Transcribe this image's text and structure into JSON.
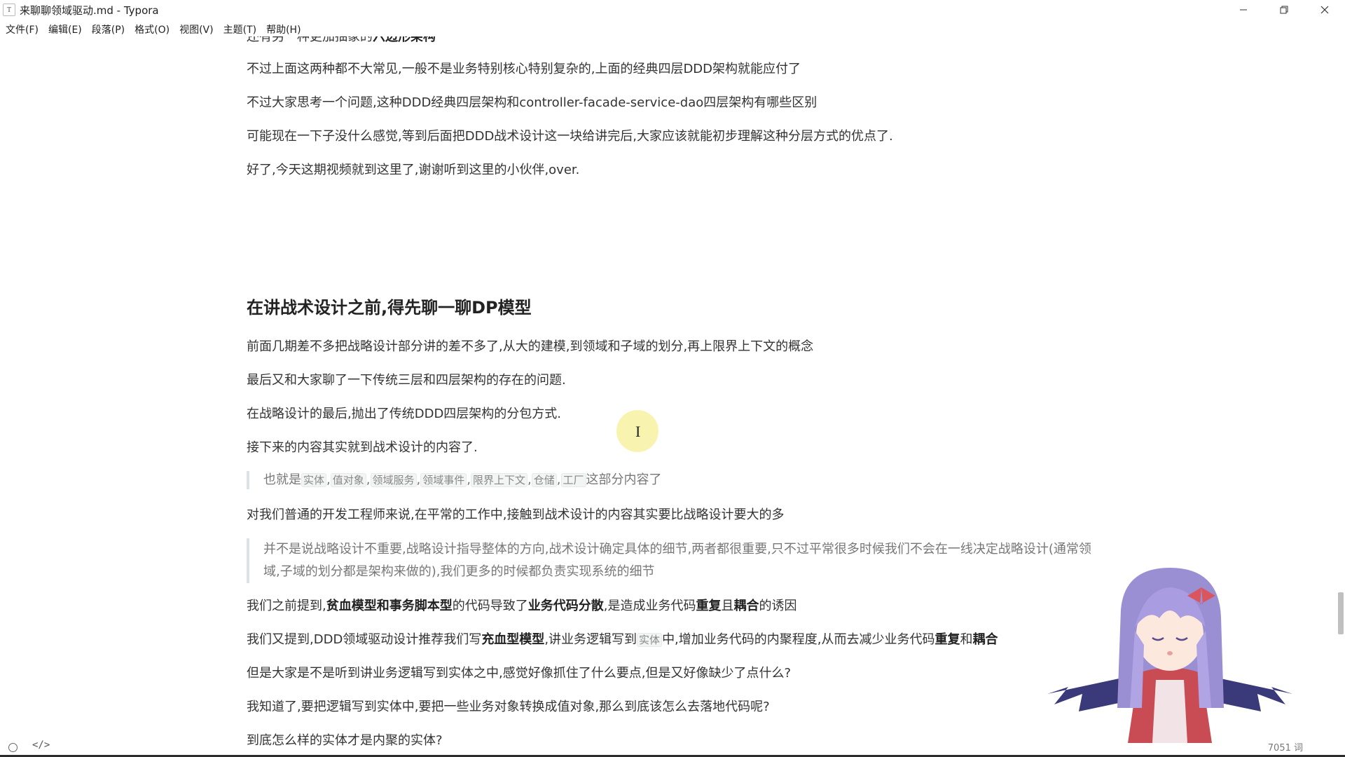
{
  "window": {
    "title": "来聊聊领域驱动.md - Typora",
    "icon_glyph": "T"
  },
  "menu": [
    {
      "label": "文件(F)"
    },
    {
      "label": "编辑(E)"
    },
    {
      "label": "段落(P)"
    },
    {
      "label": "格式(O)"
    },
    {
      "label": "视图(V)"
    },
    {
      "label": "主题(T)"
    },
    {
      "label": "帮助(H)"
    }
  ],
  "doc": {
    "cut_line": {
      "prefix": "还有另一种更加抽象的",
      "bold": "六边形架构"
    },
    "p_prev1": "不过上面这两种都不大常见,一般不是业务特别核心特别复杂的,上面的经典四层DDD架构就能应付了",
    "p_prev2": "不过大家思考一个问题,这种DDD经典四层架构和controller-facade-service-dao四层架构有哪些区别",
    "p_prev3": "可能现在一下子没什么感觉,等到后面把DDD战术设计这一块给讲完后,大家应该就能初步理解这种分层方式的优点了.",
    "p_prev4": "好了,今天这期视频就到这里了,谢谢听到这里的小伙伴,over.",
    "heading": "在讲战术设计之前,得先聊一聊DP模型",
    "p1": "前面几期差不多把战略设计部分讲的差不多了,从大的建模,到领域和子域的划分,再上限界上下文的概念",
    "p2": "最后又和大家聊了一下传统三层和四层架构的存在的问题.",
    "p3": "在战略设计的最后,抛出了传统DDD四层架构的分包方式.",
    "p4": "接下来的内容其实就到战术设计的内容了.",
    "quote1": {
      "prefix": "也就是",
      "codes": [
        "实体",
        "值对象",
        "领域服务",
        "领域事件",
        "限界上下文",
        "仓储",
        "工厂"
      ],
      "separator": ",",
      "suffix": "这部分内容了"
    },
    "p5": "对我们普通的开发工程师来说,在平常的工作中,接触到战术设计的内容其实要比战略设计要大的多",
    "quote2": "并不是说战略设计不重要,战略设计指导整体的方向,战术设计确定具体的细节,两者都很重要,只不过平常很多时候我们不会在一线决定战略设计(通常领域,子域的划分都是架构来做的),我们更多的时候都负责实现系统的细节",
    "p6": {
      "t1": "我们之前提到,",
      "b1": "贫血模型和事务脚本型",
      "t2": "的代码导致了",
      "b2": "业务代码分散",
      "t3": ",是造成业务代码",
      "b3": "重复",
      "t4": "且",
      "b4": "耦合",
      "t5": "的诱因"
    },
    "p7": {
      "t1": "我们又提到,DDD领域驱动设计推荐我们写",
      "b1": "充血型模型",
      "t2": ",讲业务逻辑写到",
      "code": "实体",
      "t3": "中,增加业务代码的内聚程度,从而去减少业务代码",
      "b2": "重复",
      "t4": "和",
      "b3": "耦合"
    },
    "p8": "但是大家是不是听到讲业务逻辑写到实体之中,感觉好像抓住了什么要点,但是又好像缺少了点什么?",
    "p9": "我知道了,要把逻辑写到实体中,要把一些业务对象转换成值对象,那么到底该怎么去落地代码呢?",
    "p10": "到底怎么样的实体才是内聚的实体?"
  },
  "status": {
    "source_toggle": "</>",
    "word_count": "7051 词"
  }
}
